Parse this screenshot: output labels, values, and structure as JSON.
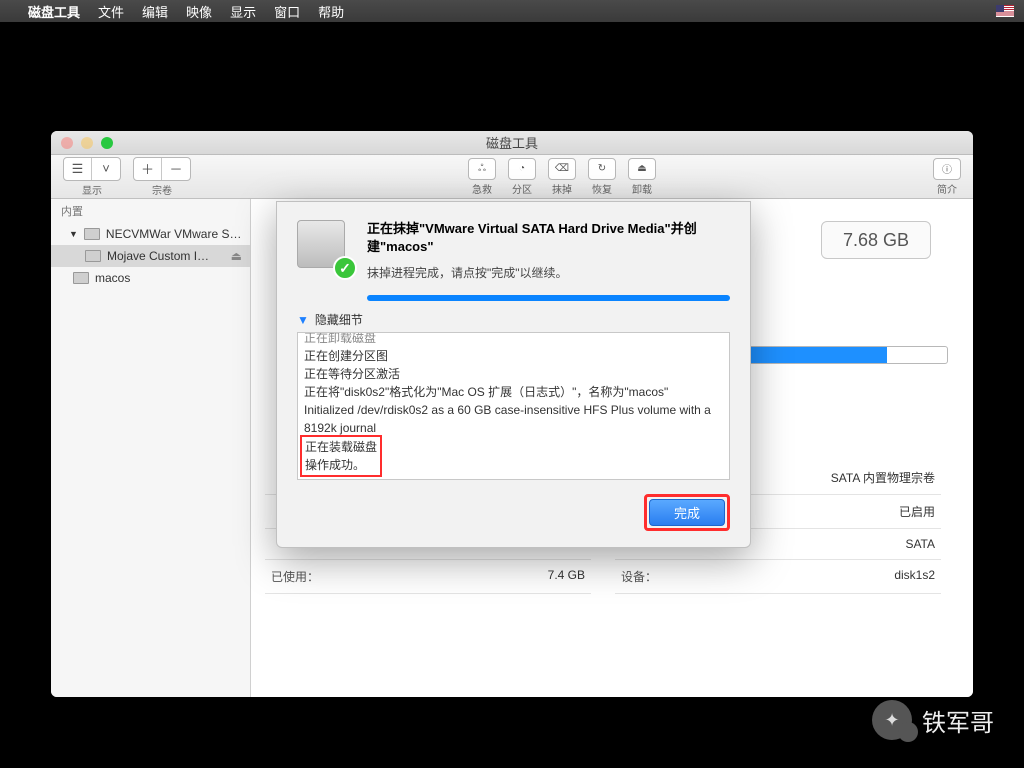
{
  "menubar": {
    "app": "磁盘工具",
    "items": [
      "文件",
      "编辑",
      "映像",
      "显示",
      "窗口",
      "帮助"
    ]
  },
  "window": {
    "title": "磁盘工具",
    "toolbar": {
      "display": "显示",
      "volume": "宗卷",
      "first_aid": "急救",
      "partition": "分区",
      "erase": "抹掉",
      "restore": "恢复",
      "unmount": "卸载",
      "info": "简介"
    }
  },
  "sidebar": {
    "section": "内置",
    "items": [
      {
        "label": "NECVMWar VMware S…"
      },
      {
        "label": "Mojave Custom I…",
        "selected": true,
        "ejectable": true
      },
      {
        "label": "macos"
      }
    ]
  },
  "main": {
    "capacity": "7.68 GB",
    "rows": [
      {
        "k": "",
        "v": "",
        "k2": "",
        "v2": "SATA 内置物理宗卷"
      },
      {
        "k": "",
        "v": "",
        "k2": "",
        "v2": "已启用"
      },
      {
        "k": "",
        "v": "",
        "k2": "",
        "v2": "SATA"
      },
      {
        "k": "已使用：",
        "v": "7.4 GB",
        "k2": "设备：",
        "v2": "disk1s2"
      }
    ]
  },
  "sheet": {
    "title": "正在抹掉\"VMware Virtual SATA Hard Drive Media\"并创建\"macos\"",
    "subtitle": "抹掉进程完成，请点按\"完成\"以继续。",
    "toggle": "隐藏细节",
    "log_top": [
      "正在卸载磁盘",
      "正在创建分区图",
      "正在等待分区激活",
      "正在将\"disk0s2\"格式化为\"Mac OS 扩展（日志式）\"，名称为\"macos\"",
      "Initialized /dev/rdisk0s2 as a 60 GB case-insensitive HFS Plus volume with a 8192k journal"
    ],
    "log_hi": [
      "正在装载磁盘",
      "",
      "操作成功。"
    ],
    "done": "完成"
  },
  "watermark": "铁军哥"
}
